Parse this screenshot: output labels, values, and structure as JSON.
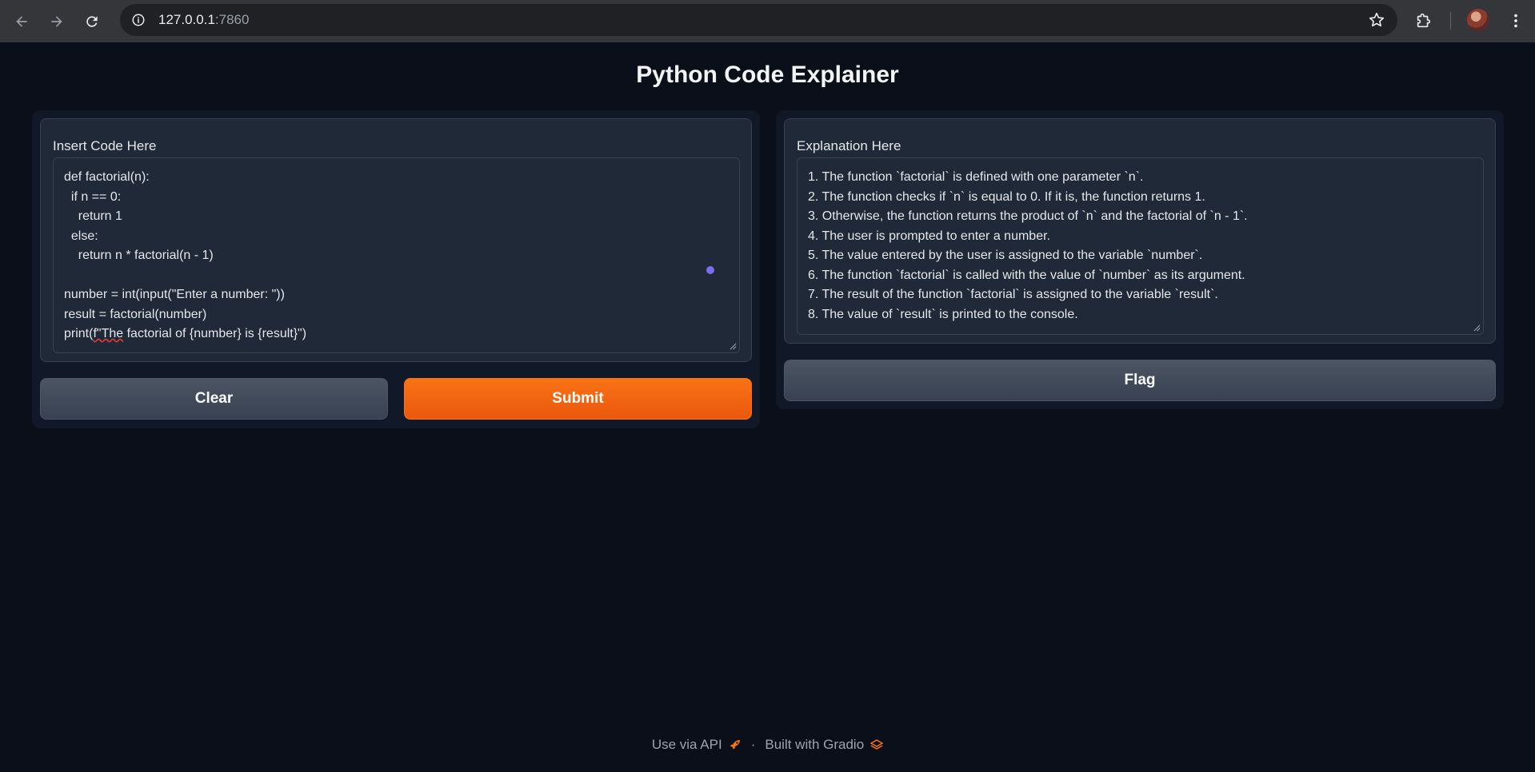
{
  "browser": {
    "url_host": "127.0.0.1",
    "url_port": ":7860"
  },
  "app": {
    "title": "Python Code Explainer"
  },
  "input": {
    "label": "Insert Code Here",
    "lines": [
      "def factorial(n):",
      "  if n == 0:",
      "    return 1",
      "  else:",
      "    return n * factorial(n - 1)",
      "",
      "number = int(input(\"Enter a number: \"))",
      "result = factorial(number)"
    ],
    "last_line_prefix": "print(",
    "last_line_squiggle": "f\"The",
    "last_line_suffix": " factorial of {number} is {result}\")"
  },
  "output": {
    "label": "Explanation Here",
    "lines": [
      "1. The function `factorial` is defined with one parameter `n`.",
      "2. The function checks if `n` is equal to 0. If it is, the function returns 1.",
      "3. Otherwise, the function returns the product of `n` and the factorial of `n - 1`.",
      "4. The user is prompted to enter a number.",
      "5. The value entered by the user is assigned to the variable `number`.",
      "6. The function `factorial` is called with the value of `number` as its argument.",
      "7. The result of the function `factorial` is assigned to the variable `result`.",
      "8. The value of `result` is printed to the console."
    ]
  },
  "buttons": {
    "clear": "Clear",
    "submit": "Submit",
    "flag": "Flag"
  },
  "footer": {
    "api": "Use via API",
    "sep": "·",
    "built": "Built with Gradio"
  },
  "colors": {
    "background": "#0b0f19",
    "accent": "#f97316"
  }
}
